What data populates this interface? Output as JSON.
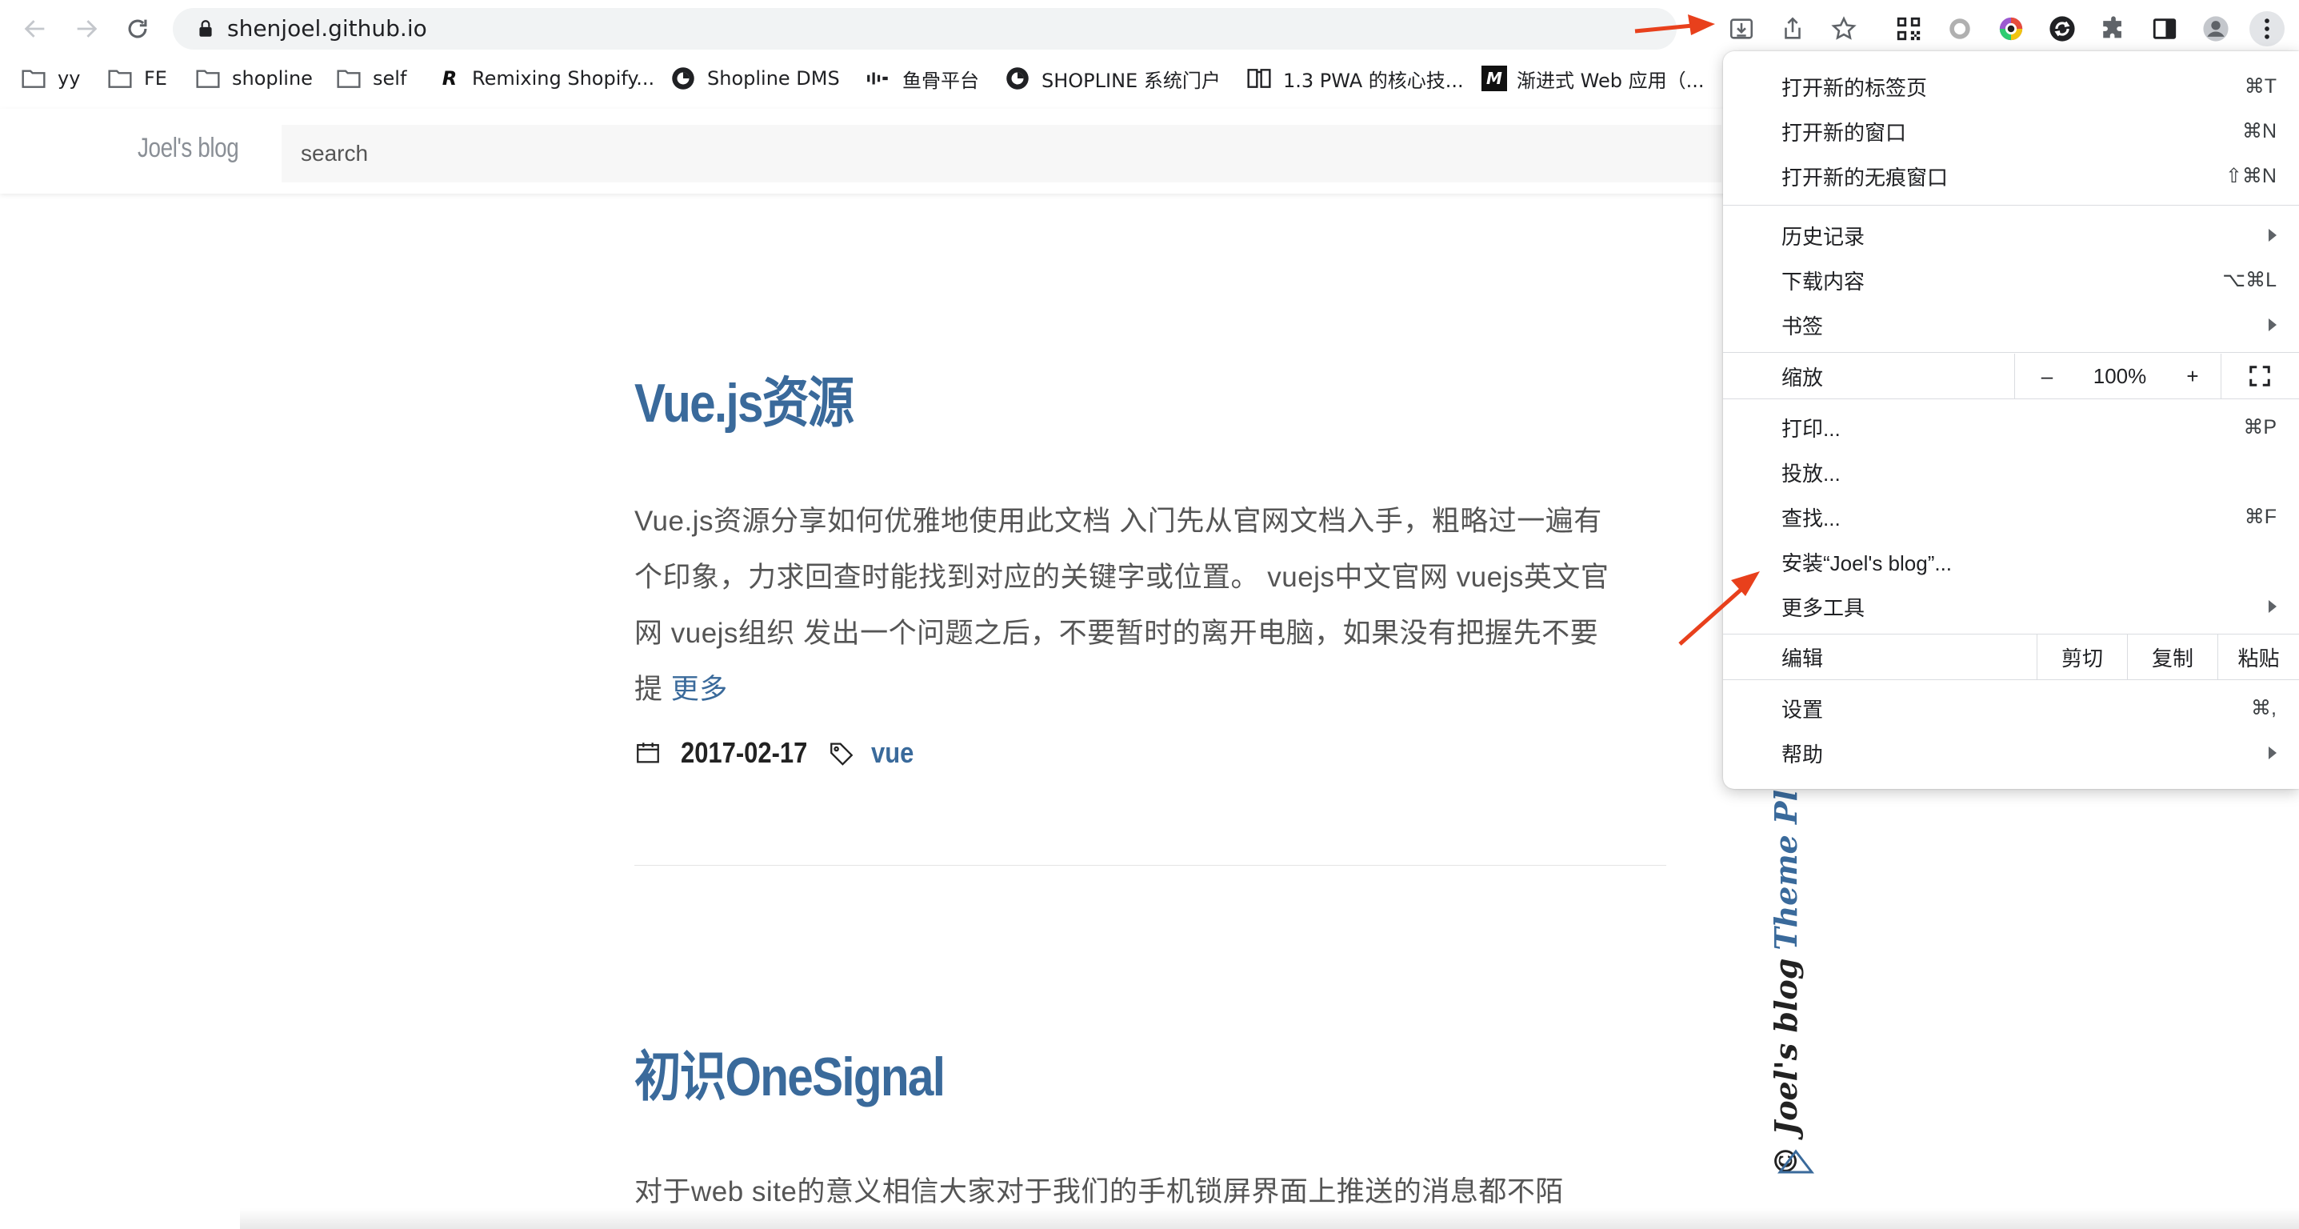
{
  "browser": {
    "url": "shenjoel.github.io",
    "bookmarks": [
      {
        "label": "yy",
        "icon": "folder-icon"
      },
      {
        "label": "FE",
        "icon": "folder-icon"
      },
      {
        "label": "shopline",
        "icon": "folder-icon"
      },
      {
        "label": "self",
        "icon": "folder-icon"
      },
      {
        "label": "Remixing Shopify...",
        "icon": "remix-icon"
      },
      {
        "label": "Shopline DMS",
        "icon": "shopline-icon"
      },
      {
        "label": "鱼骨平台",
        "icon": "fishbone-icon"
      },
      {
        "label": "SHOPLINE 系统门户",
        "icon": "shopline-icon"
      },
      {
        "label": "1.3 PWA 的核心技...",
        "icon": "book-icon"
      },
      {
        "label": "渐进式 Web 应用（...",
        "icon": "mdn-icon"
      }
    ]
  },
  "site": {
    "logo": "Joel's blog",
    "search_placeholder": "search"
  },
  "posts": [
    {
      "title": "Vue.js资源",
      "excerpt": "Vue.js资源分享如何优雅地使用此文档 入门先从官网文档入手，粗略过一遍有个印象，力求回查时能找到对应的关键字或位置。 vuejs中文官网 vuejs英文官网 vuejs组织 发出一个问题之后，不要暂时的离开电脑，如果没有把握先不要提",
      "excerpt_lines": [
        "Vue.js资源分享如何优雅地使用此文档 入门先从官网文档入手，粗略过一遍有",
        "个印象，力求回查时能找到对应的关键字或位置。 vuejs中文官网 vuejs英文官",
        "网 vuejs组织 发出一个问题之后，不要暂时的离开电脑，如果没有把握先不要",
        "提"
      ],
      "more": "更多",
      "date": "2017-02-17",
      "tag": "vue"
    },
    {
      "title": "初识OneSignal",
      "excerpt_lines": [
        "对于web site的意义相信大家对于我们的手机锁屏界面上推送的消息都不陌"
      ]
    }
  ],
  "sidebar": {
    "copyright": "© Joel's blog",
    "theme": "Theme Pln"
  },
  "menu": {
    "new_tab": {
      "label": "打开新的标签页",
      "shortcut": "⌘T"
    },
    "new_window": {
      "label": "打开新的窗口",
      "shortcut": "⌘N"
    },
    "incognito": {
      "label": "打开新的无痕窗口",
      "shortcut": "⇧⌘N"
    },
    "history": {
      "label": "历史记录"
    },
    "downloads": {
      "label": "下载内容",
      "shortcut": "⌥⌘L"
    },
    "bookmarks": {
      "label": "书签"
    },
    "zoom": {
      "label": "缩放",
      "minus": "–",
      "value": "100%",
      "plus": "+"
    },
    "print": {
      "label": "打印...",
      "shortcut": "⌘P"
    },
    "cast": {
      "label": "投放..."
    },
    "find": {
      "label": "查找...",
      "shortcut": "⌘F"
    },
    "install": {
      "label": "安装“Joel's blog”..."
    },
    "more_tools": {
      "label": "更多工具"
    },
    "edit": {
      "label": "编辑",
      "cut": "剪切",
      "copy": "复制",
      "paste": "粘贴"
    },
    "settings": {
      "label": "设置",
      "shortcut": "⌘,"
    },
    "help": {
      "label": "帮助"
    }
  },
  "colors": {
    "accent": "#3a6a9b",
    "annotation": "#e8401c"
  }
}
